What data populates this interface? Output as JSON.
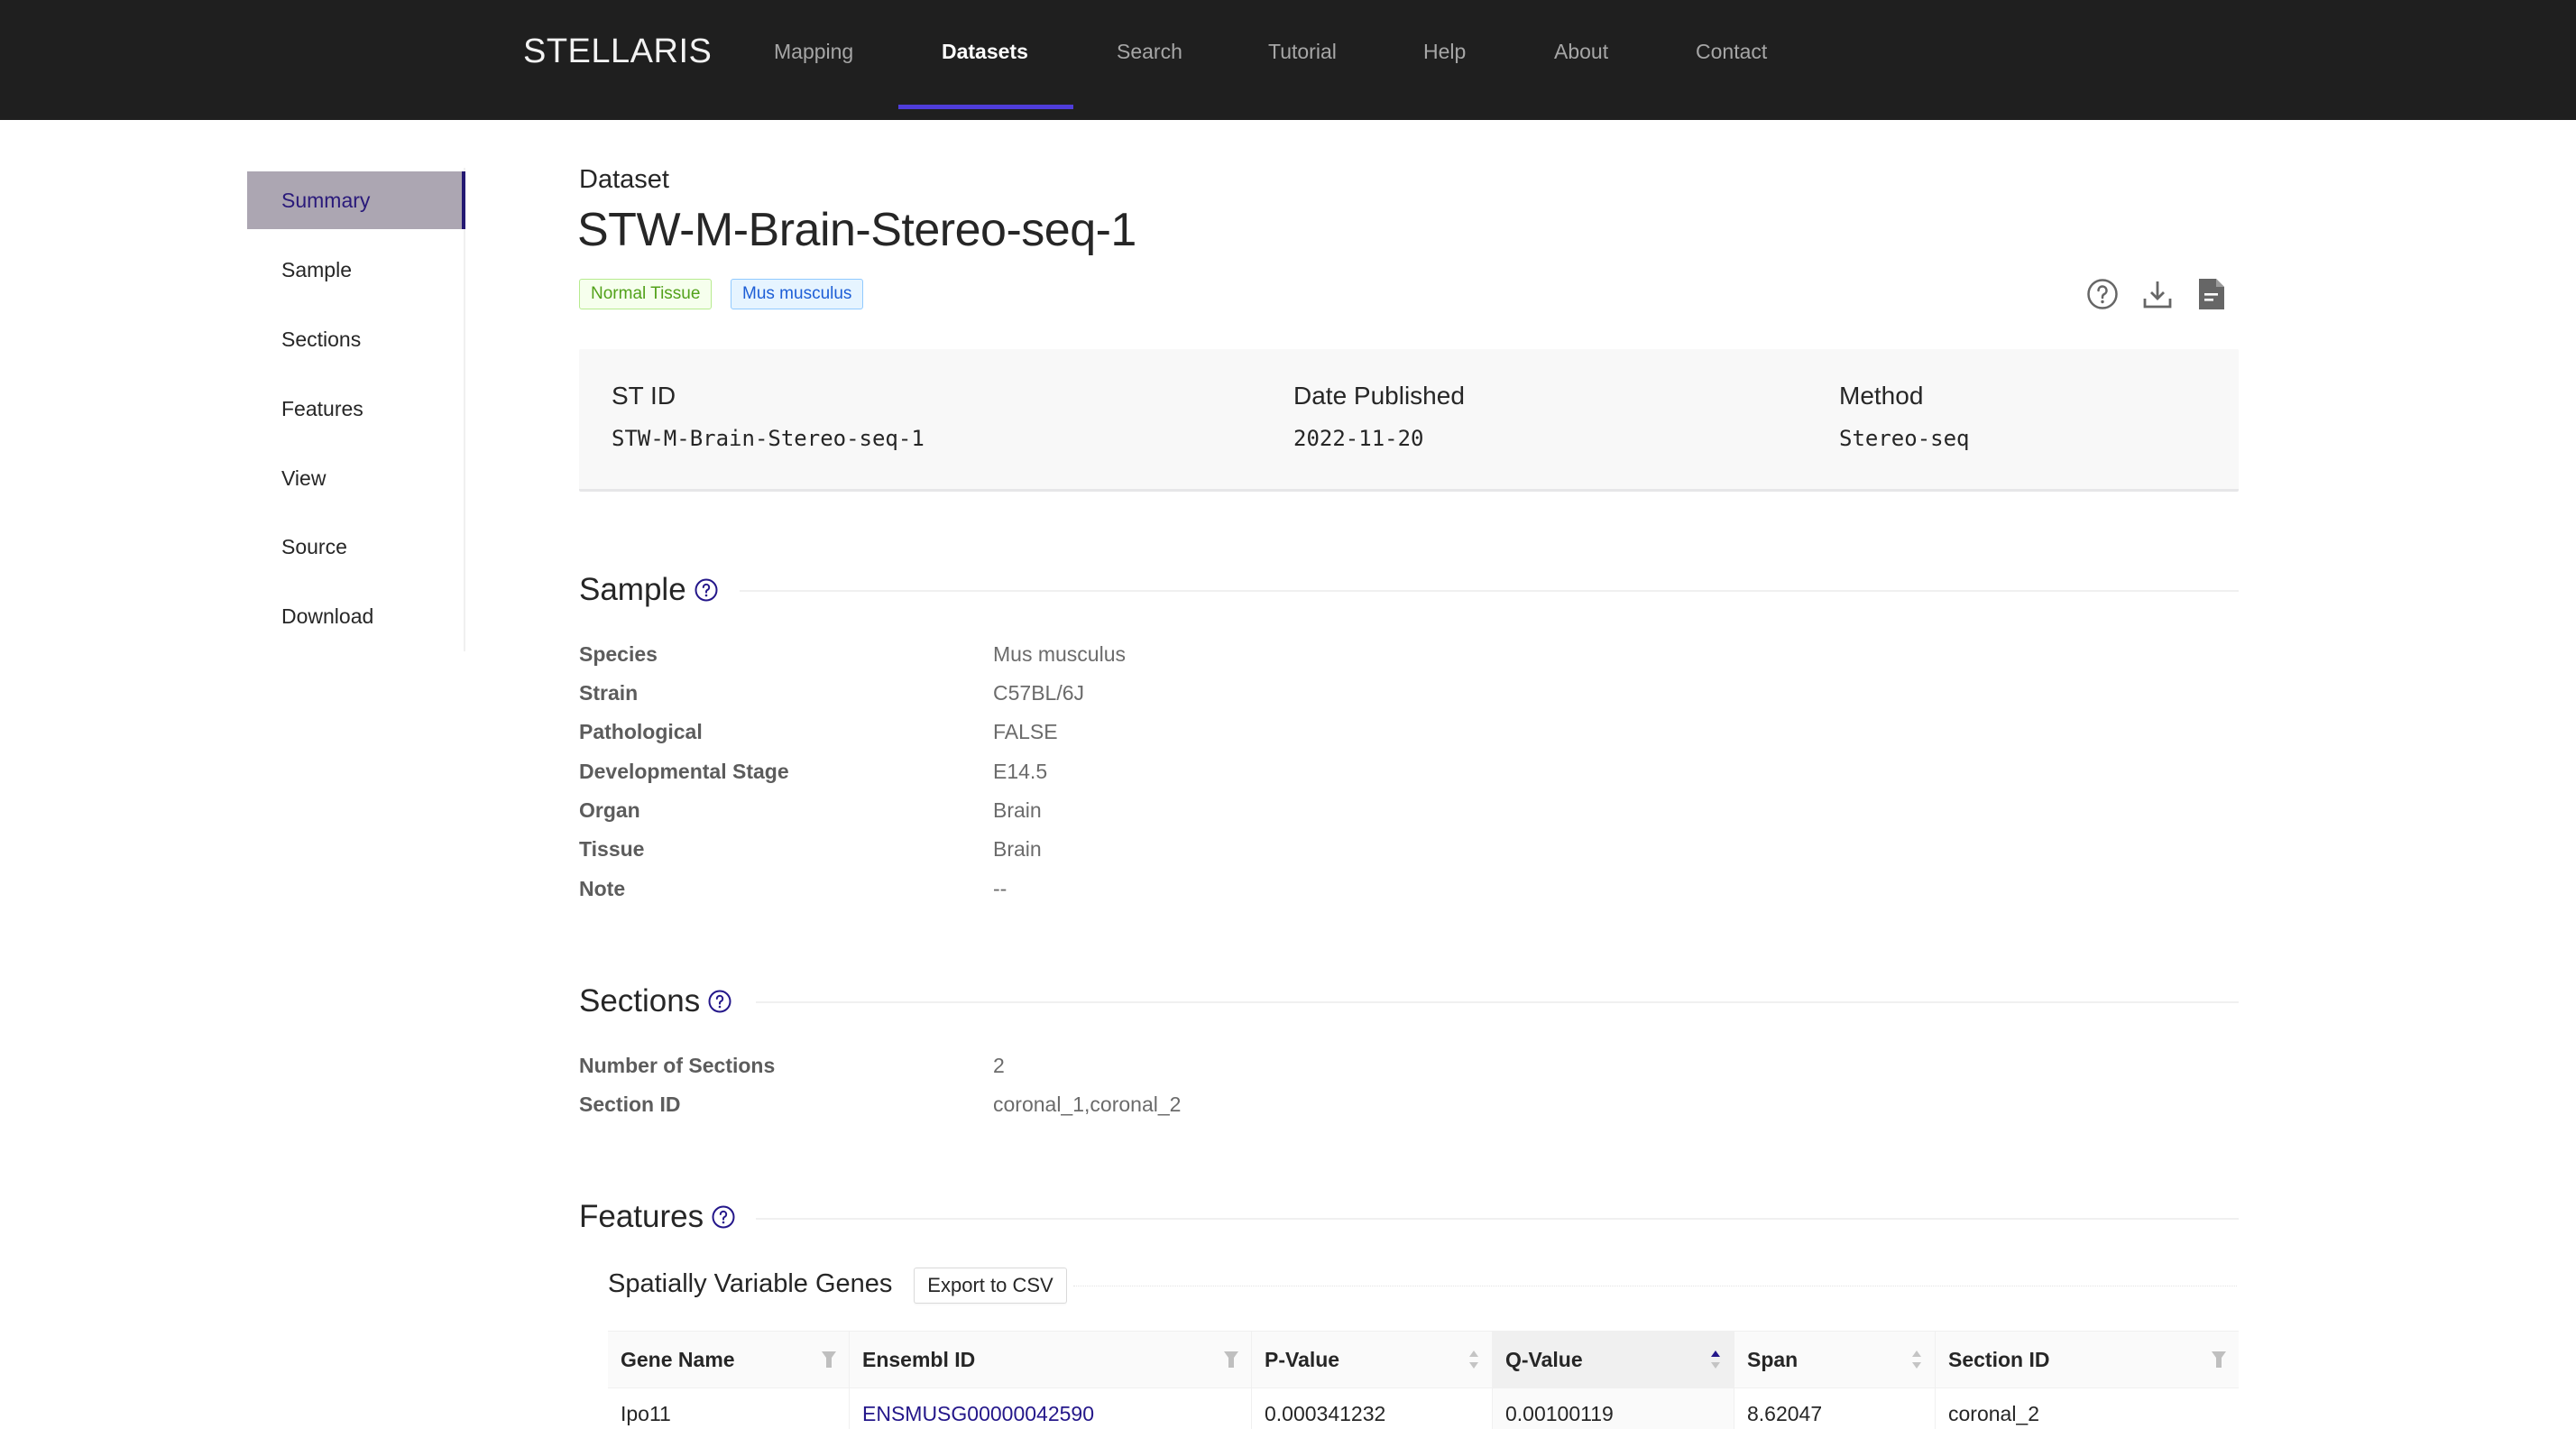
{
  "header": {
    "brand": "STELLARIS",
    "nav": [
      {
        "label": "Mapping",
        "active": false
      },
      {
        "label": "Datasets",
        "active": true
      },
      {
        "label": "Search",
        "active": false
      },
      {
        "label": "Tutorial",
        "active": false
      },
      {
        "label": "Help",
        "active": false
      },
      {
        "label": "About",
        "active": false
      },
      {
        "label": "Contact",
        "active": false
      }
    ],
    "accent_color": "#4f3ddb"
  },
  "sidebar": {
    "items": [
      {
        "label": "Summary",
        "active": true
      },
      {
        "label": "Sample",
        "active": false
      },
      {
        "label": "Sections",
        "active": false
      },
      {
        "label": "Features",
        "active": false
      },
      {
        "label": "View",
        "active": false
      },
      {
        "label": "Source",
        "active": false
      },
      {
        "label": "Download",
        "active": false
      }
    ]
  },
  "page": {
    "eyebrow": "Dataset",
    "title": "STW-M-Brain-Stereo-seq-1",
    "badges": [
      {
        "label": "Normal Tissue",
        "color": "#52a11a"
      },
      {
        "label": "Mus musculus",
        "color": "#1d5ed6"
      }
    ],
    "toolbar": {
      "icons": [
        "help-circle-icon",
        "download-icon",
        "document-icon"
      ]
    }
  },
  "summary_card": {
    "fields": [
      {
        "label": "ST ID",
        "value": "STW-M-Brain-Stereo-seq-1"
      },
      {
        "label": "Date Published",
        "value": "2022-11-20"
      },
      {
        "label": "Method",
        "value": "Stereo-seq"
      }
    ]
  },
  "sample": {
    "heading": "Sample",
    "rows": [
      {
        "label": "Species",
        "value": "Mus musculus"
      },
      {
        "label": "Strain",
        "value": "C57BL/6J"
      },
      {
        "label": "Pathological",
        "value": "FALSE"
      },
      {
        "label": "Developmental Stage",
        "value": "E14.5"
      },
      {
        "label": "Organ",
        "value": "Brain"
      },
      {
        "label": "Tissue",
        "value": "Brain"
      },
      {
        "label": "Note",
        "value": "--"
      }
    ]
  },
  "sections": {
    "heading": "Sections",
    "rows": [
      {
        "label": "Number of Sections",
        "value": "2"
      },
      {
        "label": "Section ID",
        "value": "coronal_1,coronal_2"
      }
    ]
  },
  "features": {
    "heading": "Features",
    "subheading": "Spatially Variable Genes",
    "export_label": "Export to CSV",
    "table": {
      "columns": [
        {
          "label": "Gene Name",
          "control": "filter"
        },
        {
          "label": "Ensembl ID",
          "control": "filter"
        },
        {
          "label": "P-Value",
          "control": "sort"
        },
        {
          "label": "Q-Value",
          "control": "sort-asc"
        },
        {
          "label": "Span",
          "control": "sort"
        },
        {
          "label": "Section ID",
          "control": "filter"
        }
      ],
      "rows": [
        [
          "Ipo11",
          "ENSMUSG00000042590",
          "0.000341232",
          "0.00100119",
          "8.62047",
          "coronal_2"
        ]
      ]
    }
  }
}
